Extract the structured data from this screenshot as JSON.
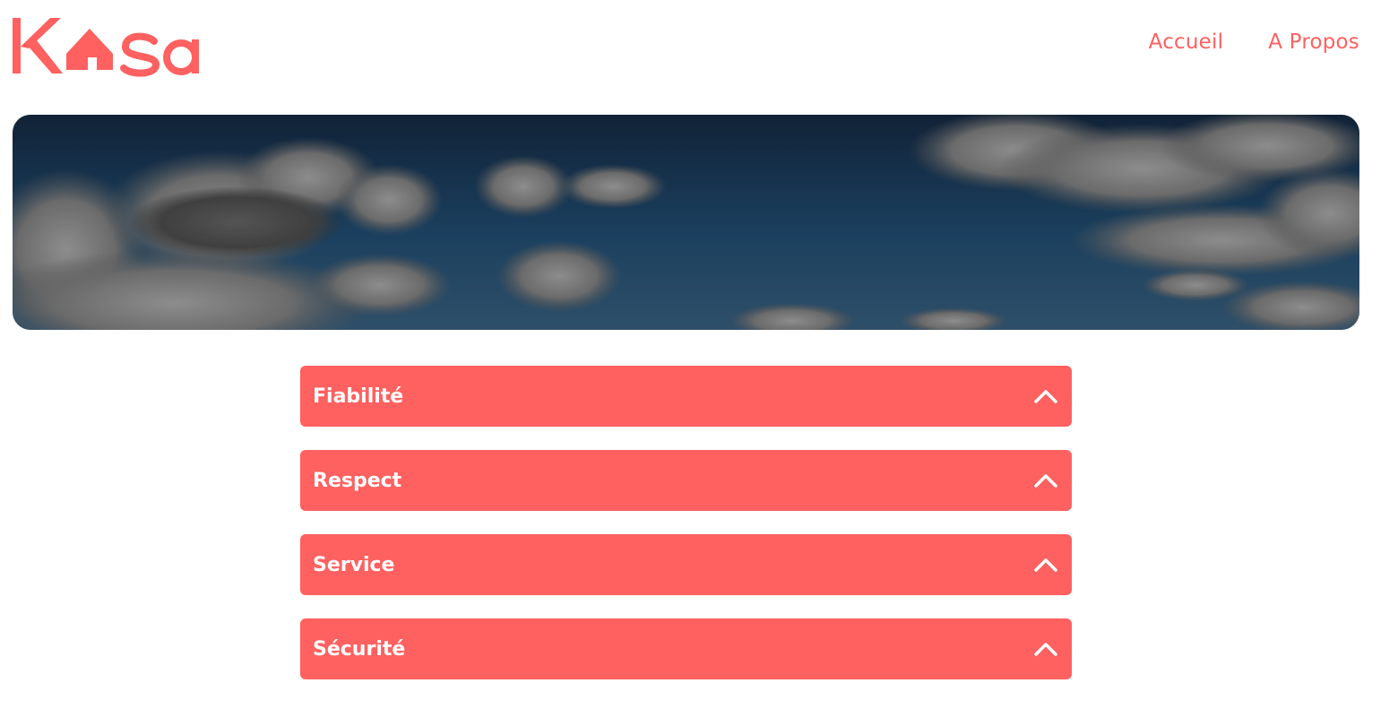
{
  "brand": {
    "name": "Kasa",
    "color": "#ff6060"
  },
  "nav": {
    "items": [
      {
        "label": "Accueil"
      },
      {
        "label": "A Propos"
      }
    ]
  },
  "banner": {
    "alt": "sky-with-clouds"
  },
  "accordion": {
    "items": [
      {
        "title": "Fiabilité",
        "icon": "chevron-up-icon"
      },
      {
        "title": "Respect",
        "icon": "chevron-up-icon"
      },
      {
        "title": "Service",
        "icon": "chevron-up-icon"
      },
      {
        "title": "Sécurité",
        "icon": "chevron-up-icon"
      }
    ]
  }
}
